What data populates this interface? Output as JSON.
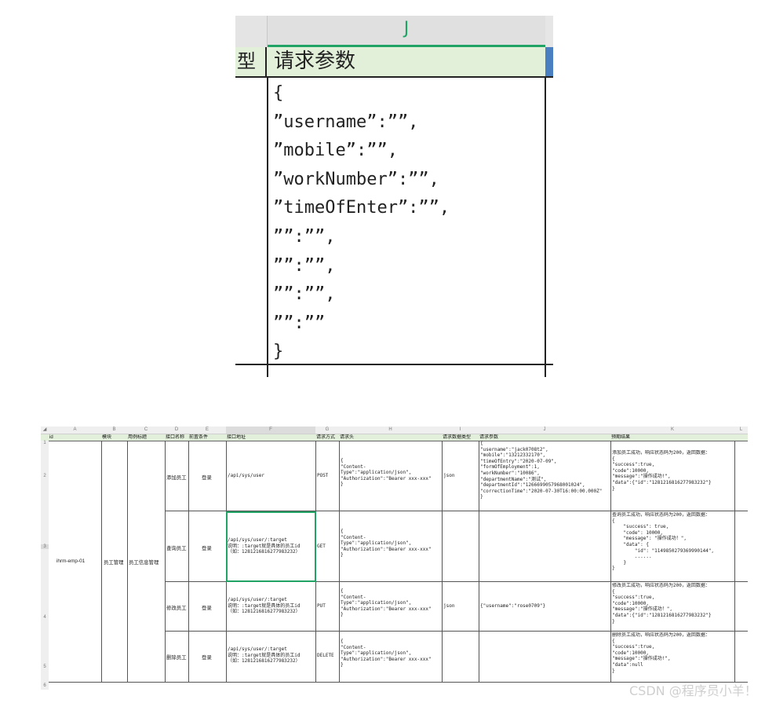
{
  "zoom": {
    "column_letter": "J",
    "left_header_fragment": "型",
    "header": "请求参数",
    "code_lines": [
      "{",
      "”username”:””,",
      "”mobile”:””,",
      "”workNumber”:””,",
      "”timeOfEnter”:””,",
      "””:””,",
      "””:””,",
      "””:””,",
      "””:””",
      "}"
    ]
  },
  "sheet": {
    "column_letters": [
      "A",
      "B",
      "C",
      "D",
      "E",
      "F",
      "G",
      "H",
      "I",
      "J",
      "K",
      "L"
    ],
    "headers": [
      "id",
      "模块",
      "用例标题",
      "接口名称",
      "前置条件",
      "接口地址",
      "请求方式",
      "请求头",
      "请求数据类型",
      "请求参数",
      "预期结果"
    ],
    "row_numbers": [
      "1",
      "2",
      "3",
      "4",
      "5",
      "6"
    ],
    "id_value": "ihrm-emp-01",
    "module_value": "员工管理",
    "title_value": "员工信息管理",
    "rows": [
      {
        "name": "添加员工",
        "pre": "登录",
        "url": "/api/sys/user",
        "method": "POST",
        "headers": "{\n\"Content-\nType\":\"application/json\",\n\"Authorization\":\"Bearer xxx-xxx\"\n}",
        "dtype": "json",
        "params": "{\n\"username\":\"jack0708t2\",\n\"mobile\":\"13212332170\",\n\"timeOfEntry\":\"2020-07-09\",\n\"formOfEmployment\":1,\n\"workNumber\":\"10086\",\n\"departmentName\":\"测试\",\n\"departmentId\":\"1266699057968001024\",\n\"correctionTime\":\"2020-07-30T16:00:00.000Z\"\n}",
        "expected": "添加员工成功，响应状态码为200，返回数据：\n{\n\"success\":true,\n\"code\":10000,\n\"message\":\"操作成功!\",\n\"data\":{\"id\":\"1281216816277983232\"}\n}"
      },
      {
        "name": "查询员工",
        "pre": "登录",
        "url": "/api/sys/user/:target\n说明：:target就是具体的员工id\n（如：1281216816277983232）",
        "method": "GET",
        "headers": "{\n\"Content-\nType\":\"application/json\",\n\"Authorization\":\"Bearer xxx-xxx\"\n}",
        "dtype": "",
        "params": "",
        "expected": "查询员工成功，响应状态码为200，返回数据：\n{\n    \"success\": true,\n    \"code\": 10000,\n    \"message\": \"操作成功！\",\n    \"data\": {\n        \"id\": \"1149850279369990144\",\n        ......\n    }\n}"
      },
      {
        "name": "修改员工",
        "pre": "登录",
        "url": "/api/sys/user/:target\n说明：:target就是具体的员工id\n（如：1281216816277983232）",
        "method": "PUT",
        "headers": "{\n\"Content-\nType\":\"application/json\",\n\"Authorization\":\"Bearer xxx-xxx\"\n}",
        "dtype": "json",
        "params": "{\"username\":\"rose0709\"}",
        "expected": "修改员工成功，响应状态码为200，返回数据：\n{\n\"success\":true,\n\"code\":10000,\n\"message\":\"操作成功！\",\n\"data\":{\"id\":\"1281216816277983232\"}\n}"
      },
      {
        "name": "删除员工",
        "pre": "登录",
        "url": "/api/sys/user/:target\n说明：:target就是具体的员工id\n（如：1281216816277983232）",
        "method": "DELETE",
        "headers": "{\n\"Content-\nType\":\"application/json\",\n\"Authorization\":\"Bearer xxx-xxx\"\n}",
        "dtype": "",
        "params": "",
        "expected": "删除员工成功，响应状态码为200，返回数据：\n{\n\"success\":true,\n\"code\":10000,\n\"message\":\"操作成功!\",\n\"data\":null\n}"
      }
    ]
  },
  "watermark": "CSDN @程序员小羊！",
  "colors": {
    "excel_green": "#21a366",
    "header_fill": "#e2efda",
    "selection_blue": "#4a7fc1"
  }
}
